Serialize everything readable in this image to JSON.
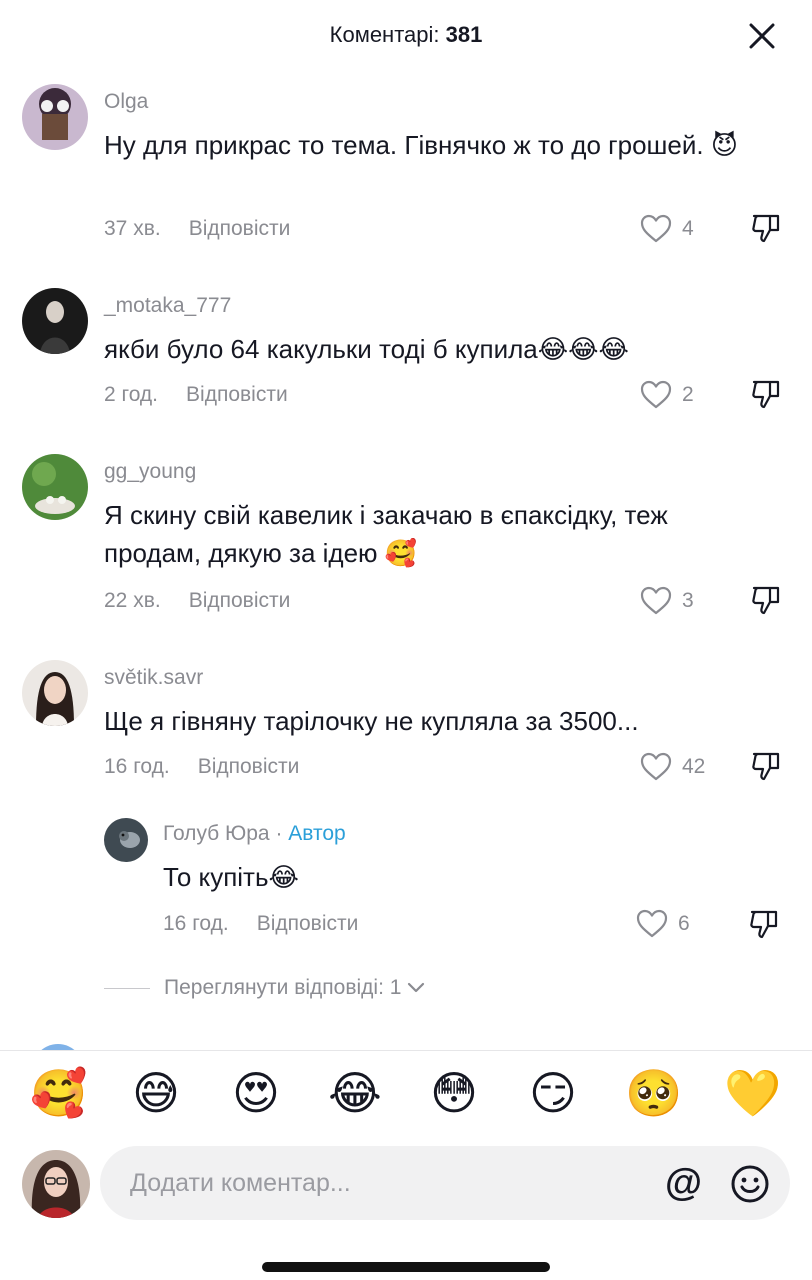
{
  "header": {
    "title_label": "Коментарі:",
    "count": "381"
  },
  "comments": [
    {
      "user": "Olga",
      "text": "Ну для прикрас то тема. Гівнячко ж то до грошей. 😈",
      "time": "37 хв.",
      "reply": "Відповісти",
      "likes": "4"
    },
    {
      "user": "_motaka_777",
      "text": "якби було 64 какульки тоді б купила😂😂😂",
      "time": "2 год.",
      "reply": "Відповісти",
      "likes": "2"
    },
    {
      "user": "gg_young",
      "text": "Я скину свій кавелик і закачаю в єпаксідку, теж продам, дякую за ідею 🥰",
      "time": "22 хв.",
      "reply": "Відповісти",
      "likes": "3"
    },
    {
      "user": "světik.savr",
      "text": "Ще я гівняну тарілочку не купляла за 3500...",
      "time": "16 год.",
      "reply": "Відповісти",
      "likes": "42"
    }
  ],
  "reply_comment": {
    "user": "Голуб Юра",
    "separator": " · ",
    "author_tag": "Автор",
    "text": "То купіть😂",
    "time": "16 год.",
    "reply": "Відповісти",
    "likes": "6"
  },
  "view_replies": {
    "label": "Переглянути відповіді: 1"
  },
  "emoji_bar": [
    "🥰",
    "😅",
    "😍",
    "😂",
    "😳",
    "😏",
    "🥺",
    "💛"
  ],
  "composer": {
    "placeholder": "Додати коментар...",
    "at_symbol": "@"
  },
  "colors": {
    "author_tag": "#2b9fd9",
    "secondary_text": "#8a8b91",
    "input_bg": "#f1f1f2"
  }
}
